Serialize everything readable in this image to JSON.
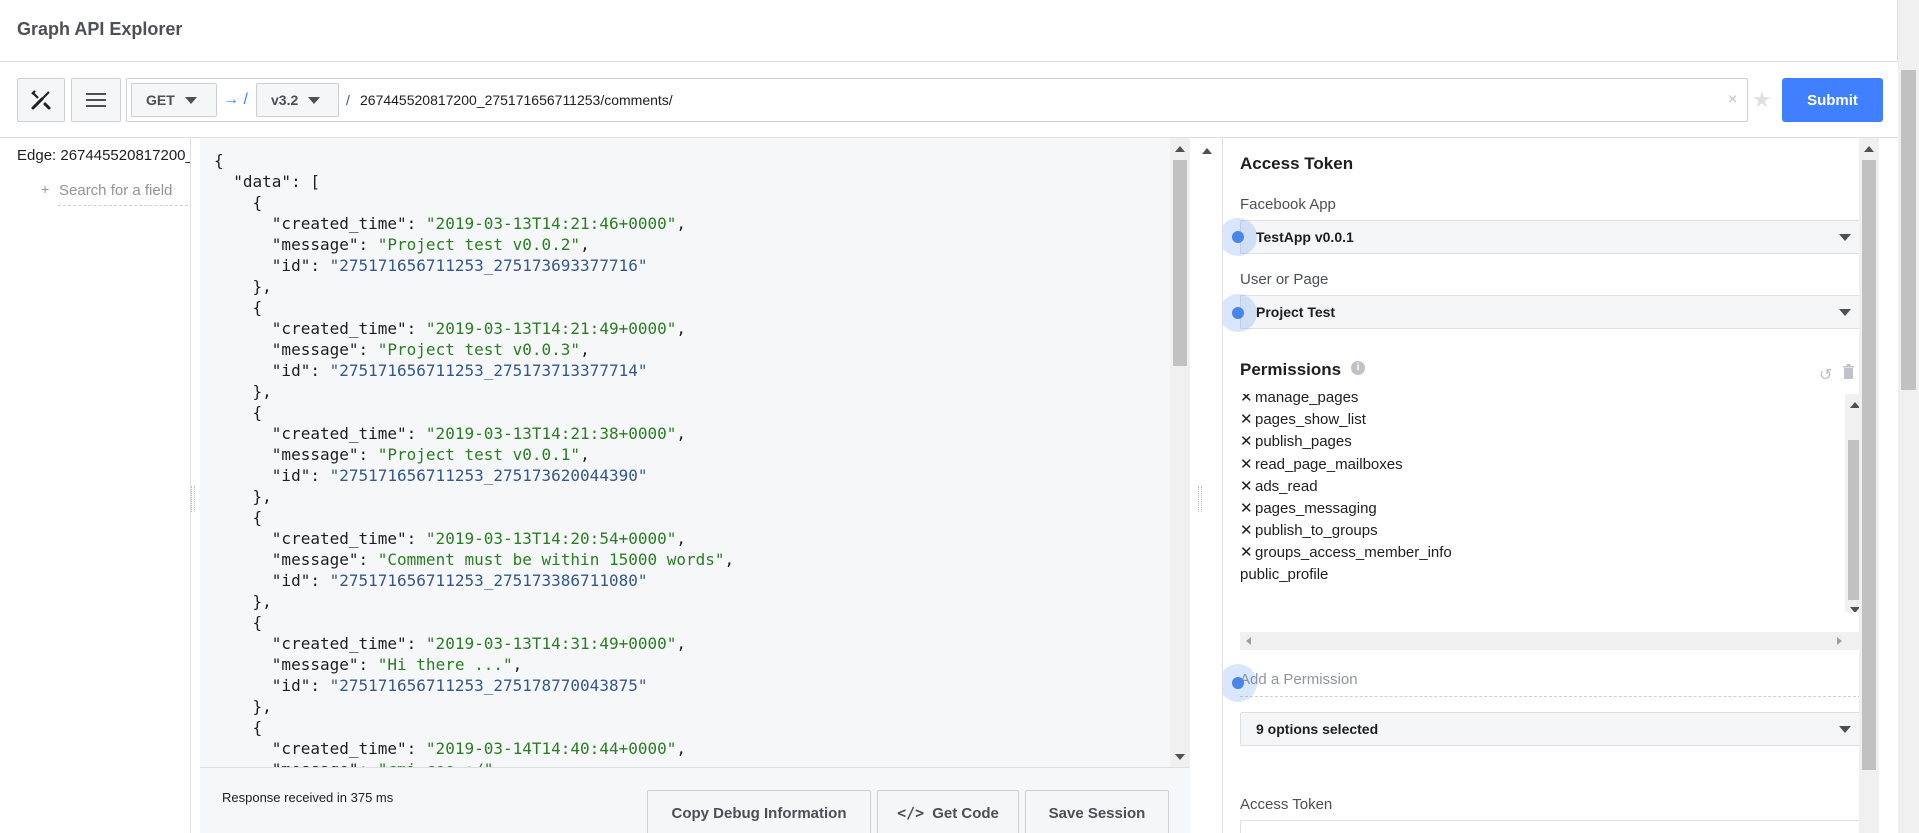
{
  "app": {
    "title": "Graph API Explorer"
  },
  "toolbar": {
    "method": "GET",
    "arrow": "→ /",
    "version": "v3.2",
    "slash": "/",
    "path": "267445520817200_275171656711253/comments/",
    "clear": "×",
    "star": "★",
    "submit_label": "Submit"
  },
  "left_pane": {
    "edge_label": "Edge:",
    "edge_value": "267445520817200_",
    "search_plus": "+",
    "search_placeholder": "Search for a field"
  },
  "response": {
    "json_lines": [
      "{",
      "  \"data\": [",
      "    {",
      "      \"created_time\": \"2019-03-13T14:21:46+0000\",",
      "      \"message\": \"Project test v0.0.2\",",
      "      \"id\": \"275171656711253_275173693377716\"",
      "    },",
      "    {",
      "      \"created_time\": \"2019-03-13T14:21:49+0000\",",
      "      \"message\": \"Project test v0.0.3\",",
      "      \"id\": \"275171656711253_275173713377714\"",
      "    },",
      "    {",
      "      \"created_time\": \"2019-03-13T14:21:38+0000\",",
      "      \"message\": \"Project test v0.0.1\",",
      "      \"id\": \"275171656711253_275173620044390\"",
      "    },",
      "    {",
      "      \"created_time\": \"2019-03-13T14:20:54+0000\",",
      "      \"message\": \"Comment must be within 15000 words\",",
      "      \"id\": \"275171656711253_275173386711080\"",
      "    },",
      "    {",
      "      \"created_time\": \"2019-03-13T14:31:49+0000\",",
      "      \"message\": \"Hi there ...\",",
      "      \"id\": \"275171656711253_275178770043875\"",
      "    },",
      "    {",
      "      \"created_time\": \"2019-03-14T14:40:44+0000\",",
      "      \"message\": \"cmi coo :/\","
    ],
    "status": "Response received in 375 ms",
    "copy_debug_label": "Copy Debug Information",
    "get_code_label": "Get Code",
    "save_session_label": "Save Session"
  },
  "access_panel": {
    "title": "Access Token",
    "facebook_app_label": "Facebook App",
    "facebook_app_value": "TestApp v0.0.1",
    "user_or_page_label": "User or Page",
    "user_or_page_value": "Project Test",
    "permissions_title": "Permissions",
    "permissions": [
      {
        "name": "manage_pages",
        "removable": true
      },
      {
        "name": "pages_show_list",
        "removable": true
      },
      {
        "name": "publish_pages",
        "removable": true
      },
      {
        "name": "read_page_mailboxes",
        "removable": true
      },
      {
        "name": "ads_read",
        "removable": true
      },
      {
        "name": "pages_messaging",
        "removable": true
      },
      {
        "name": "publish_to_groups",
        "removable": true
      },
      {
        "name": "groups_access_member_info",
        "removable": true
      },
      {
        "name": "public_profile",
        "removable": false
      }
    ],
    "remove_glyph": "✕",
    "add_permission_placeholder": "Add a Permission",
    "options_selected": "9 options selected",
    "access_token_label": "Access Token"
  },
  "colors": {
    "accent": "#4080ff",
    "json_string": "#2a7e22",
    "json_id": "#36578b",
    "focus_dot": "#4a86e8"
  }
}
